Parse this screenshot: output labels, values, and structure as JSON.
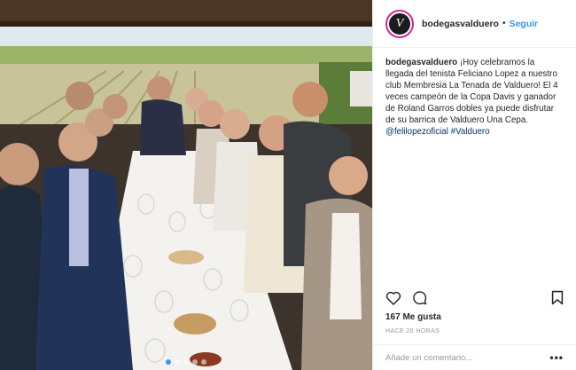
{
  "post": {
    "username": "bodegasvalduero",
    "separator": "•",
    "follow_label": "Seguir",
    "avatar_letter": "V",
    "caption_user": "bodegasvalduero",
    "caption_text": " ¡Hoy celebramos la llegada del tenista Feliciano Lopez a nuestro club Membresia La Tenada de Valduero! El 4 veces campeón de la Copa Davis y ganador de Roland Garros dobles ya puede disfrutar de su barrica de Valduero Una Cepa. ",
    "mention": "@felilopezoficial",
    "hashtag": "#Valduero",
    "likes": "167 Me gusta",
    "time_ago": "HACE 20 HORAS",
    "comment_placeholder": "Añade un comentario...",
    "more_label": "•••",
    "carousel": {
      "count": 5,
      "active": 0
    }
  },
  "icons": {
    "like": "heart-icon",
    "comment": "comment-icon",
    "save": "bookmark-icon",
    "more": "more-options-icon"
  },
  "colors": {
    "follow": "#3897f0",
    "text": "#262626",
    "muted": "#999999",
    "hashtag": "#003569",
    "avatar_ring": "#d6249f"
  }
}
